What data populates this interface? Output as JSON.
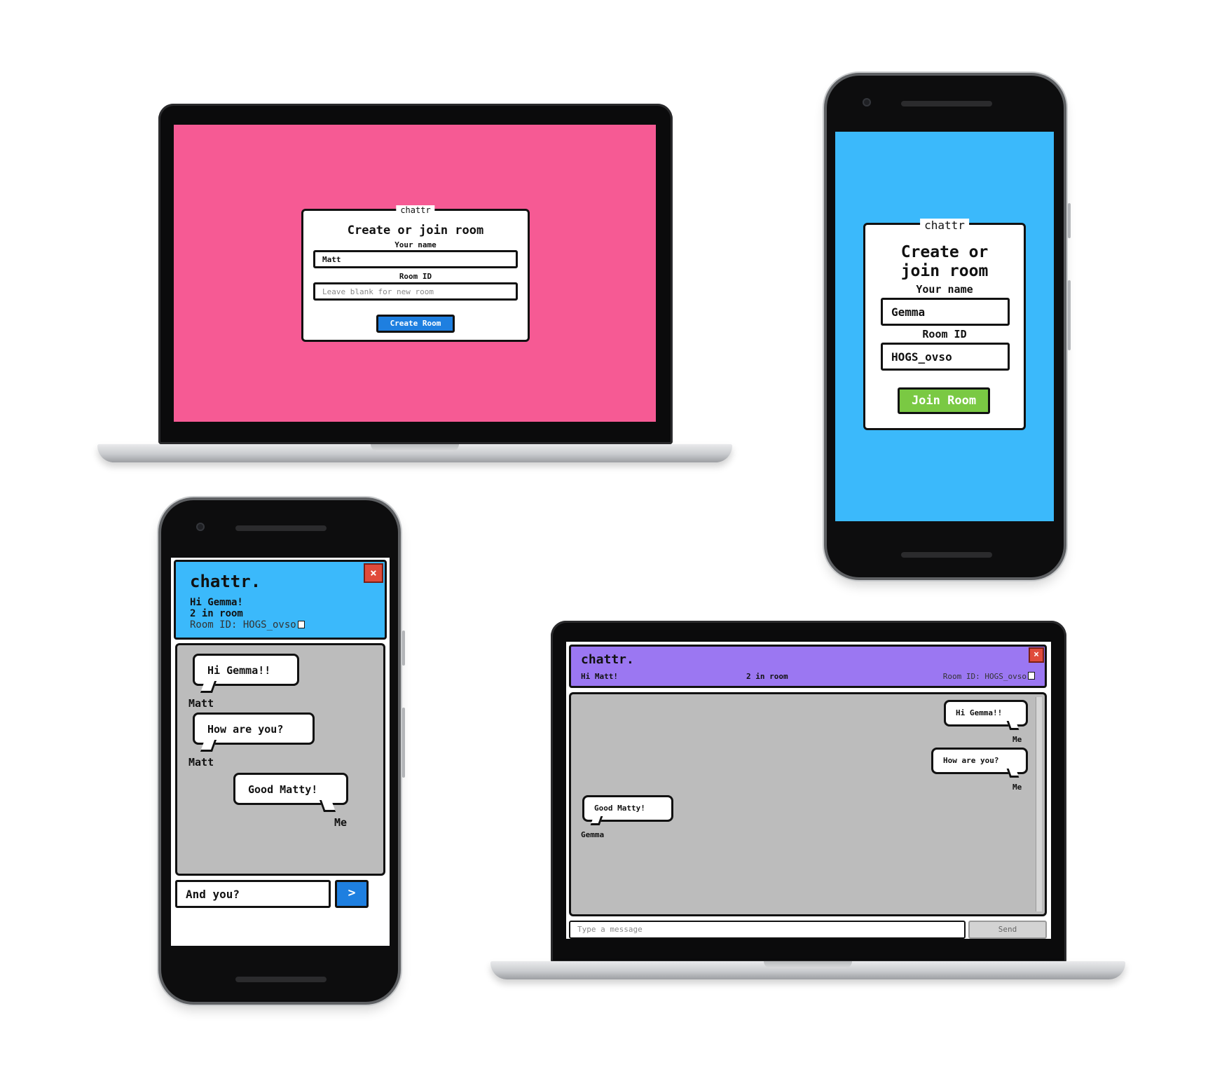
{
  "colors": {
    "pink": "#f65a94",
    "sky": "#3bb9fb",
    "purple": "#9b77f2",
    "chat_gray": "#bcbcbc",
    "create_btn": "#1e7fe0",
    "join_btn": "#7ac943",
    "close": "#e04b3b"
  },
  "laptop_top": {
    "legend": "chattr",
    "title": "Create or join room",
    "name_label": "Your name",
    "name_value": "Matt",
    "room_label": "Room ID",
    "room_placeholder": "Leave blank for new room",
    "button": "Create Room"
  },
  "phone_top": {
    "legend": "chattr",
    "title_line1": "Create or",
    "title_line2": "join room",
    "name_label": "Your name",
    "name_value": "Gemma",
    "room_label": "Room ID",
    "room_value": "HOGS_ovso",
    "button": "Join Room"
  },
  "phone_chat": {
    "brand": "chattr.",
    "greeting": "Hi Gemma!",
    "count": "2 in room",
    "room": "Room ID: HOGS_ovso",
    "close_icon": "close-icon",
    "messages": [
      {
        "text": "Hi Gemma!!",
        "sender": "Matt"
      },
      {
        "text": "How are you?",
        "sender": "Matt"
      },
      {
        "text": "Good Matty!",
        "sender": "Me"
      }
    ],
    "input_value": "And you?",
    "send_glyph": ">"
  },
  "laptop_chat": {
    "brand": "chattr.",
    "greeting": "Hi Matt!",
    "count": "2 in room",
    "room": "Room ID: HOGS_ovso",
    "messages": [
      {
        "text": "Hi Gemma!!",
        "sender": "Me"
      },
      {
        "text": "How are you?",
        "sender": "Me"
      },
      {
        "text": "Good Matty!",
        "sender": "Gemma"
      }
    ],
    "input_placeholder": "Type a message",
    "send_label": "Send"
  }
}
